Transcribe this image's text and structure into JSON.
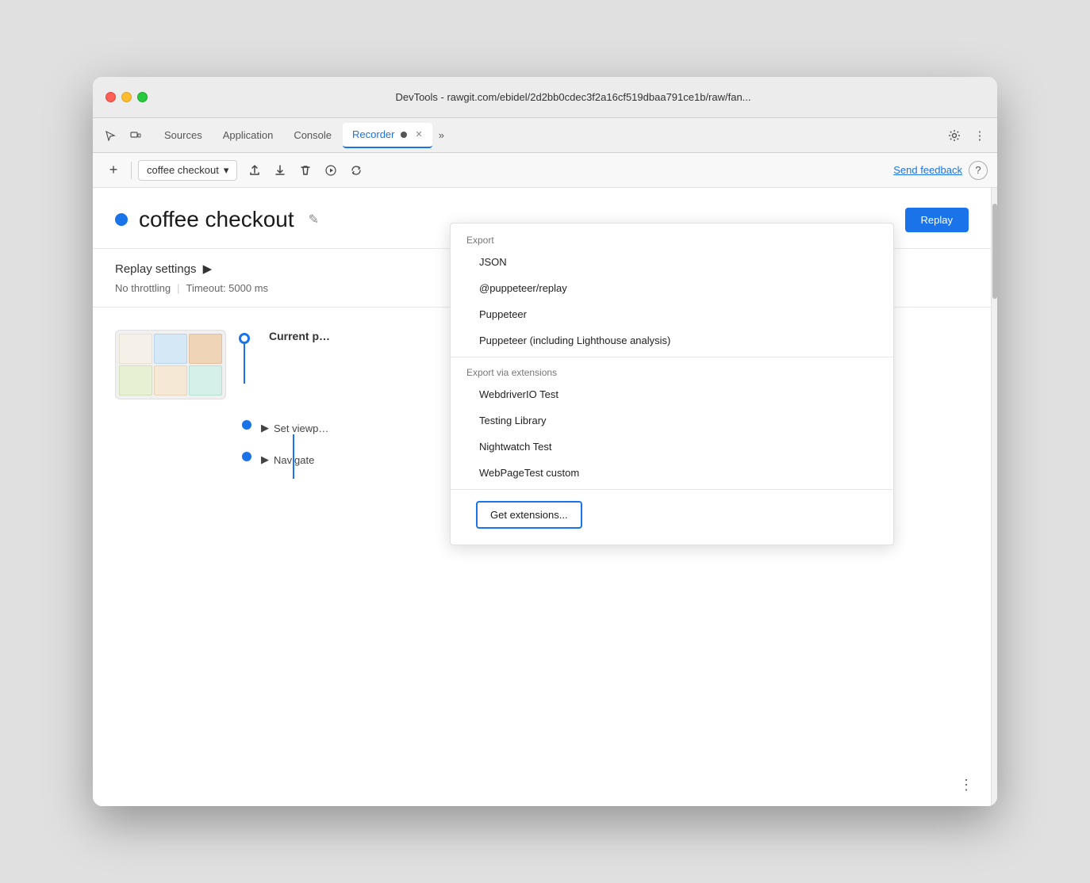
{
  "window": {
    "title": "DevTools - rawgit.com/ebidel/2d2bb0cdec3f2a16cf519dbaa791ce1b/raw/fan..."
  },
  "tabs": [
    {
      "id": "sources",
      "label": "Sources",
      "active": false
    },
    {
      "id": "application",
      "label": "Application",
      "active": false
    },
    {
      "id": "console",
      "label": "Console",
      "active": false
    },
    {
      "id": "recorder",
      "label": "Recorder",
      "active": true
    }
  ],
  "tab_more": "»",
  "toolbar": {
    "add_label": "+",
    "recording_name": "coffee checkout",
    "chevron": "▾",
    "send_feedback": "Send feedback",
    "help": "?"
  },
  "recording": {
    "title": "coffee checkout",
    "dot_color": "#1a73e8",
    "replay_button": "Replay"
  },
  "settings": {
    "title": "Replay settings",
    "arrow": "▶",
    "throttle": "No throttling",
    "timeout": "Timeout: 5000 ms"
  },
  "steps": [
    {
      "id": "step-1",
      "label": "Current p",
      "has_thumbnail": true
    },
    {
      "id": "step-2",
      "label": "Set viewp",
      "prefix": "▶"
    },
    {
      "id": "step-3",
      "label": "Navigate",
      "prefix": "▶"
    }
  ],
  "dropdown": {
    "export_label": "Export",
    "export_items": [
      {
        "id": "json",
        "label": "JSON"
      },
      {
        "id": "puppeteer-replay",
        "label": "@puppeteer/replay"
      },
      {
        "id": "puppeteer",
        "label": "Puppeteer"
      },
      {
        "id": "puppeteer-lighthouse",
        "label": "Puppeteer (including Lighthouse analysis)"
      }
    ],
    "extensions_label": "Export via extensions",
    "extensions_items": [
      {
        "id": "webdriverio",
        "label": "WebdriverIO Test"
      },
      {
        "id": "testing-library",
        "label": "Testing Library"
      },
      {
        "id": "nightwatch",
        "label": "Nightwatch Test"
      },
      {
        "id": "webpagetest",
        "label": "WebPageTest custom"
      }
    ],
    "get_extensions_label": "Get extensions..."
  }
}
